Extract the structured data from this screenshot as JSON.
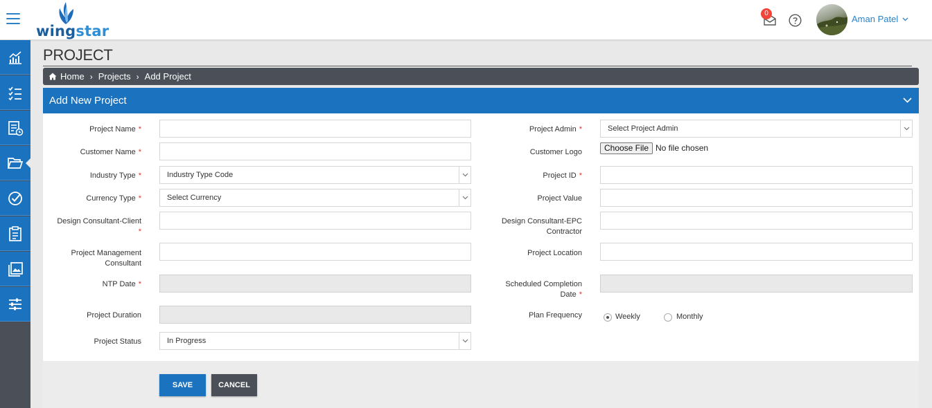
{
  "app": {
    "logo": "wingstar",
    "logo_prefix": "wing",
    "logo_suffix": "star"
  },
  "header": {
    "notification_count": "0",
    "user_name": "Aman Patel"
  },
  "sidebar": {
    "items": [
      {
        "icon": "analytics-chart-icon"
      },
      {
        "icon": "checklist-icon"
      },
      {
        "icon": "report-clock-icon"
      },
      {
        "icon": "folder-open-icon",
        "active": true
      },
      {
        "icon": "check-circle-icon"
      },
      {
        "icon": "clipboard-icon"
      },
      {
        "icon": "gallery-icon"
      },
      {
        "icon": "sliders-icon"
      }
    ]
  },
  "page": {
    "title": "PROJECT"
  },
  "breadcrumb": {
    "home": "Home",
    "projects": "Projects",
    "current": "Add Project"
  },
  "form": {
    "header": "Add New Project",
    "project_name": {
      "label": "Project Name",
      "value": ""
    },
    "customer_name": {
      "label": "Customer Name",
      "value": ""
    },
    "industry_type": {
      "label": "Industry Type",
      "value": "Industry Type Code"
    },
    "currency_type": {
      "label": "Currency Type",
      "value": "Select Currency"
    },
    "design_consultant_client": {
      "label": "Design Consultant-Client",
      "value": ""
    },
    "project_management_consultant": {
      "label_line1": "Project Management",
      "label_line2": "Consultant",
      "value": ""
    },
    "ntp_date": {
      "label": "NTP Date",
      "value": ""
    },
    "project_duration": {
      "label": "Project Duration",
      "value": ""
    },
    "project_status": {
      "label": "Project Status",
      "value": "In Progress"
    },
    "project_admin": {
      "label": "Project Admin",
      "value": "Select Project Admin"
    },
    "customer_logo": {
      "label": "Customer Logo",
      "button": "Choose File",
      "status": "No file chosen"
    },
    "project_id": {
      "label": "Project ID",
      "value": ""
    },
    "project_value": {
      "label": "Project Value",
      "value": ""
    },
    "design_consultant_epc": {
      "label_line1": "Design Consultant-EPC",
      "label_line2": "Contractor",
      "value": ""
    },
    "project_location": {
      "label": "Project Location",
      "value": ""
    },
    "scheduled_completion": {
      "label_line1": "Scheduled Completion",
      "label_line2": "Date",
      "value": ""
    },
    "plan_frequency": {
      "label": "Plan Frequency",
      "options": [
        "Weekly",
        "Monthly"
      ],
      "selected": "Weekly"
    },
    "required_mark": "*"
  },
  "actions": {
    "save": "SAVE",
    "cancel": "CANCEL"
  },
  "colors": {
    "primary": "#1b72bf",
    "dark": "#4a4f58",
    "required": "#e0322c",
    "badge": "#f0453a"
  }
}
